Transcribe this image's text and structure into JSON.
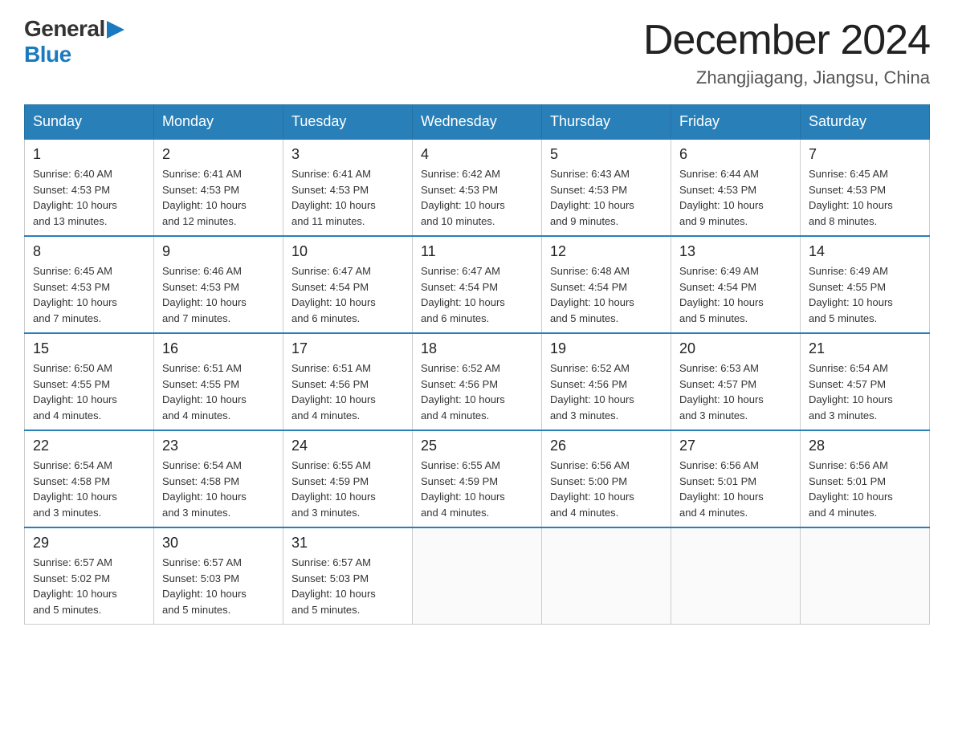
{
  "header": {
    "logo_general": "General",
    "logo_blue": "Blue",
    "month_title": "December 2024",
    "location": "Zhangjiagang, Jiangsu, China"
  },
  "days_of_week": [
    "Sunday",
    "Monday",
    "Tuesday",
    "Wednesday",
    "Thursday",
    "Friday",
    "Saturday"
  ],
  "weeks": [
    [
      {
        "day": "1",
        "sunrise": "6:40 AM",
        "sunset": "4:53 PM",
        "daylight": "10 hours and 13 minutes."
      },
      {
        "day": "2",
        "sunrise": "6:41 AM",
        "sunset": "4:53 PM",
        "daylight": "10 hours and 12 minutes."
      },
      {
        "day": "3",
        "sunrise": "6:41 AM",
        "sunset": "4:53 PM",
        "daylight": "10 hours and 11 minutes."
      },
      {
        "day": "4",
        "sunrise": "6:42 AM",
        "sunset": "4:53 PM",
        "daylight": "10 hours and 10 minutes."
      },
      {
        "day": "5",
        "sunrise": "6:43 AM",
        "sunset": "4:53 PM",
        "daylight": "10 hours and 9 minutes."
      },
      {
        "day": "6",
        "sunrise": "6:44 AM",
        "sunset": "4:53 PM",
        "daylight": "10 hours and 9 minutes."
      },
      {
        "day": "7",
        "sunrise": "6:45 AM",
        "sunset": "4:53 PM",
        "daylight": "10 hours and 8 minutes."
      }
    ],
    [
      {
        "day": "8",
        "sunrise": "6:45 AM",
        "sunset": "4:53 PM",
        "daylight": "10 hours and 7 minutes."
      },
      {
        "day": "9",
        "sunrise": "6:46 AM",
        "sunset": "4:53 PM",
        "daylight": "10 hours and 7 minutes."
      },
      {
        "day": "10",
        "sunrise": "6:47 AM",
        "sunset": "4:54 PM",
        "daylight": "10 hours and 6 minutes."
      },
      {
        "day": "11",
        "sunrise": "6:47 AM",
        "sunset": "4:54 PM",
        "daylight": "10 hours and 6 minutes."
      },
      {
        "day": "12",
        "sunrise": "6:48 AM",
        "sunset": "4:54 PM",
        "daylight": "10 hours and 5 minutes."
      },
      {
        "day": "13",
        "sunrise": "6:49 AM",
        "sunset": "4:54 PM",
        "daylight": "10 hours and 5 minutes."
      },
      {
        "day": "14",
        "sunrise": "6:49 AM",
        "sunset": "4:55 PM",
        "daylight": "10 hours and 5 minutes."
      }
    ],
    [
      {
        "day": "15",
        "sunrise": "6:50 AM",
        "sunset": "4:55 PM",
        "daylight": "10 hours and 4 minutes."
      },
      {
        "day": "16",
        "sunrise": "6:51 AM",
        "sunset": "4:55 PM",
        "daylight": "10 hours and 4 minutes."
      },
      {
        "day": "17",
        "sunrise": "6:51 AM",
        "sunset": "4:56 PM",
        "daylight": "10 hours and 4 minutes."
      },
      {
        "day": "18",
        "sunrise": "6:52 AM",
        "sunset": "4:56 PM",
        "daylight": "10 hours and 4 minutes."
      },
      {
        "day": "19",
        "sunrise": "6:52 AM",
        "sunset": "4:56 PM",
        "daylight": "10 hours and 3 minutes."
      },
      {
        "day": "20",
        "sunrise": "6:53 AM",
        "sunset": "4:57 PM",
        "daylight": "10 hours and 3 minutes."
      },
      {
        "day": "21",
        "sunrise": "6:54 AM",
        "sunset": "4:57 PM",
        "daylight": "10 hours and 3 minutes."
      }
    ],
    [
      {
        "day": "22",
        "sunrise": "6:54 AM",
        "sunset": "4:58 PM",
        "daylight": "10 hours and 3 minutes."
      },
      {
        "day": "23",
        "sunrise": "6:54 AM",
        "sunset": "4:58 PM",
        "daylight": "10 hours and 3 minutes."
      },
      {
        "day": "24",
        "sunrise": "6:55 AM",
        "sunset": "4:59 PM",
        "daylight": "10 hours and 3 minutes."
      },
      {
        "day": "25",
        "sunrise": "6:55 AM",
        "sunset": "4:59 PM",
        "daylight": "10 hours and 4 minutes."
      },
      {
        "day": "26",
        "sunrise": "6:56 AM",
        "sunset": "5:00 PM",
        "daylight": "10 hours and 4 minutes."
      },
      {
        "day": "27",
        "sunrise": "6:56 AM",
        "sunset": "5:01 PM",
        "daylight": "10 hours and 4 minutes."
      },
      {
        "day": "28",
        "sunrise": "6:56 AM",
        "sunset": "5:01 PM",
        "daylight": "10 hours and 4 minutes."
      }
    ],
    [
      {
        "day": "29",
        "sunrise": "6:57 AM",
        "sunset": "5:02 PM",
        "daylight": "10 hours and 5 minutes."
      },
      {
        "day": "30",
        "sunrise": "6:57 AM",
        "sunset": "5:03 PM",
        "daylight": "10 hours and 5 minutes."
      },
      {
        "day": "31",
        "sunrise": "6:57 AM",
        "sunset": "5:03 PM",
        "daylight": "10 hours and 5 minutes."
      },
      null,
      null,
      null,
      null
    ]
  ],
  "labels": {
    "sunrise": "Sunrise:",
    "sunset": "Sunset:",
    "daylight": "Daylight:"
  }
}
